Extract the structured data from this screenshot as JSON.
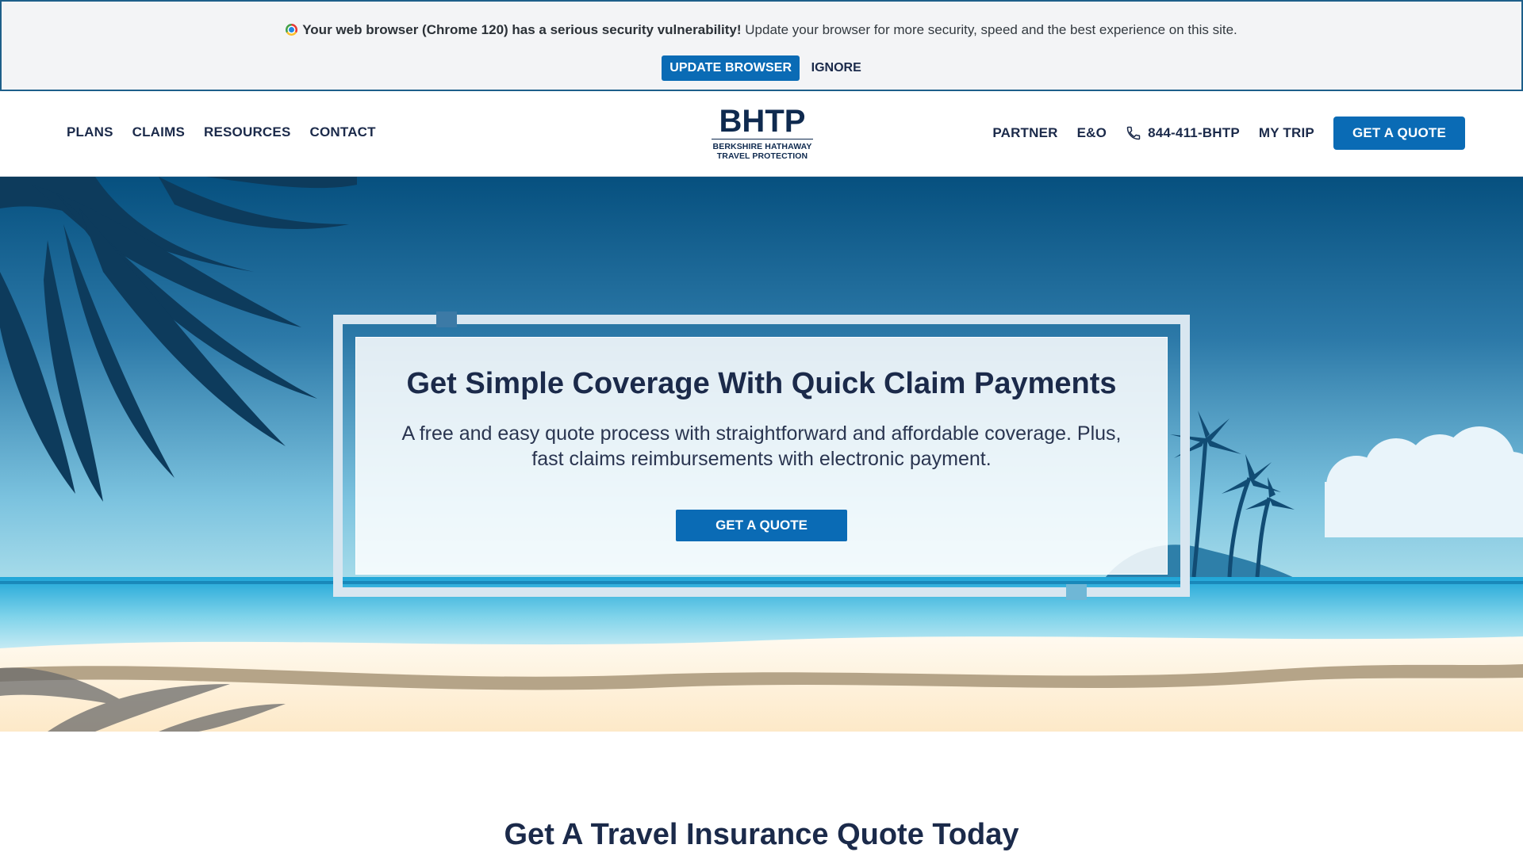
{
  "update_banner": {
    "icon": "chrome-icon",
    "bold_text": "Your web browser (Chrome 120) has a serious security vulnerability!",
    "text": " Update your browser for more security, speed and the best experience on this site.",
    "update_label": "UPDATE BROWSER",
    "ignore_label": "IGNORE"
  },
  "header": {
    "nav_left": [
      "PLANS",
      "CLAIMS",
      "RESOURCES",
      "CONTACT"
    ],
    "logo": {
      "mark": "BHTP",
      "line1": "BERKSHIRE HATHAWAY",
      "line2": "TRAVEL PROTECTION"
    },
    "nav_right": {
      "partner": "PARTNER",
      "eo": "E&O",
      "phone": "844-411-BHTP",
      "my_trip": "MY TRIP",
      "quote": "GET A QUOTE"
    }
  },
  "hero": {
    "title": "Get Simple Coverage With Quick Claim Payments",
    "subtitle": "A free and easy quote process with straightforward and affordable coverage. Plus, fast claims reimbursements with electronic payment.",
    "cta": "GET A QUOTE"
  },
  "section": {
    "heading": "Get A Travel Insurance Quote Today"
  },
  "colors": {
    "primary": "#0a6bb5",
    "navy": "#1b2a4a",
    "banner_bg": "#f3f4f6"
  }
}
